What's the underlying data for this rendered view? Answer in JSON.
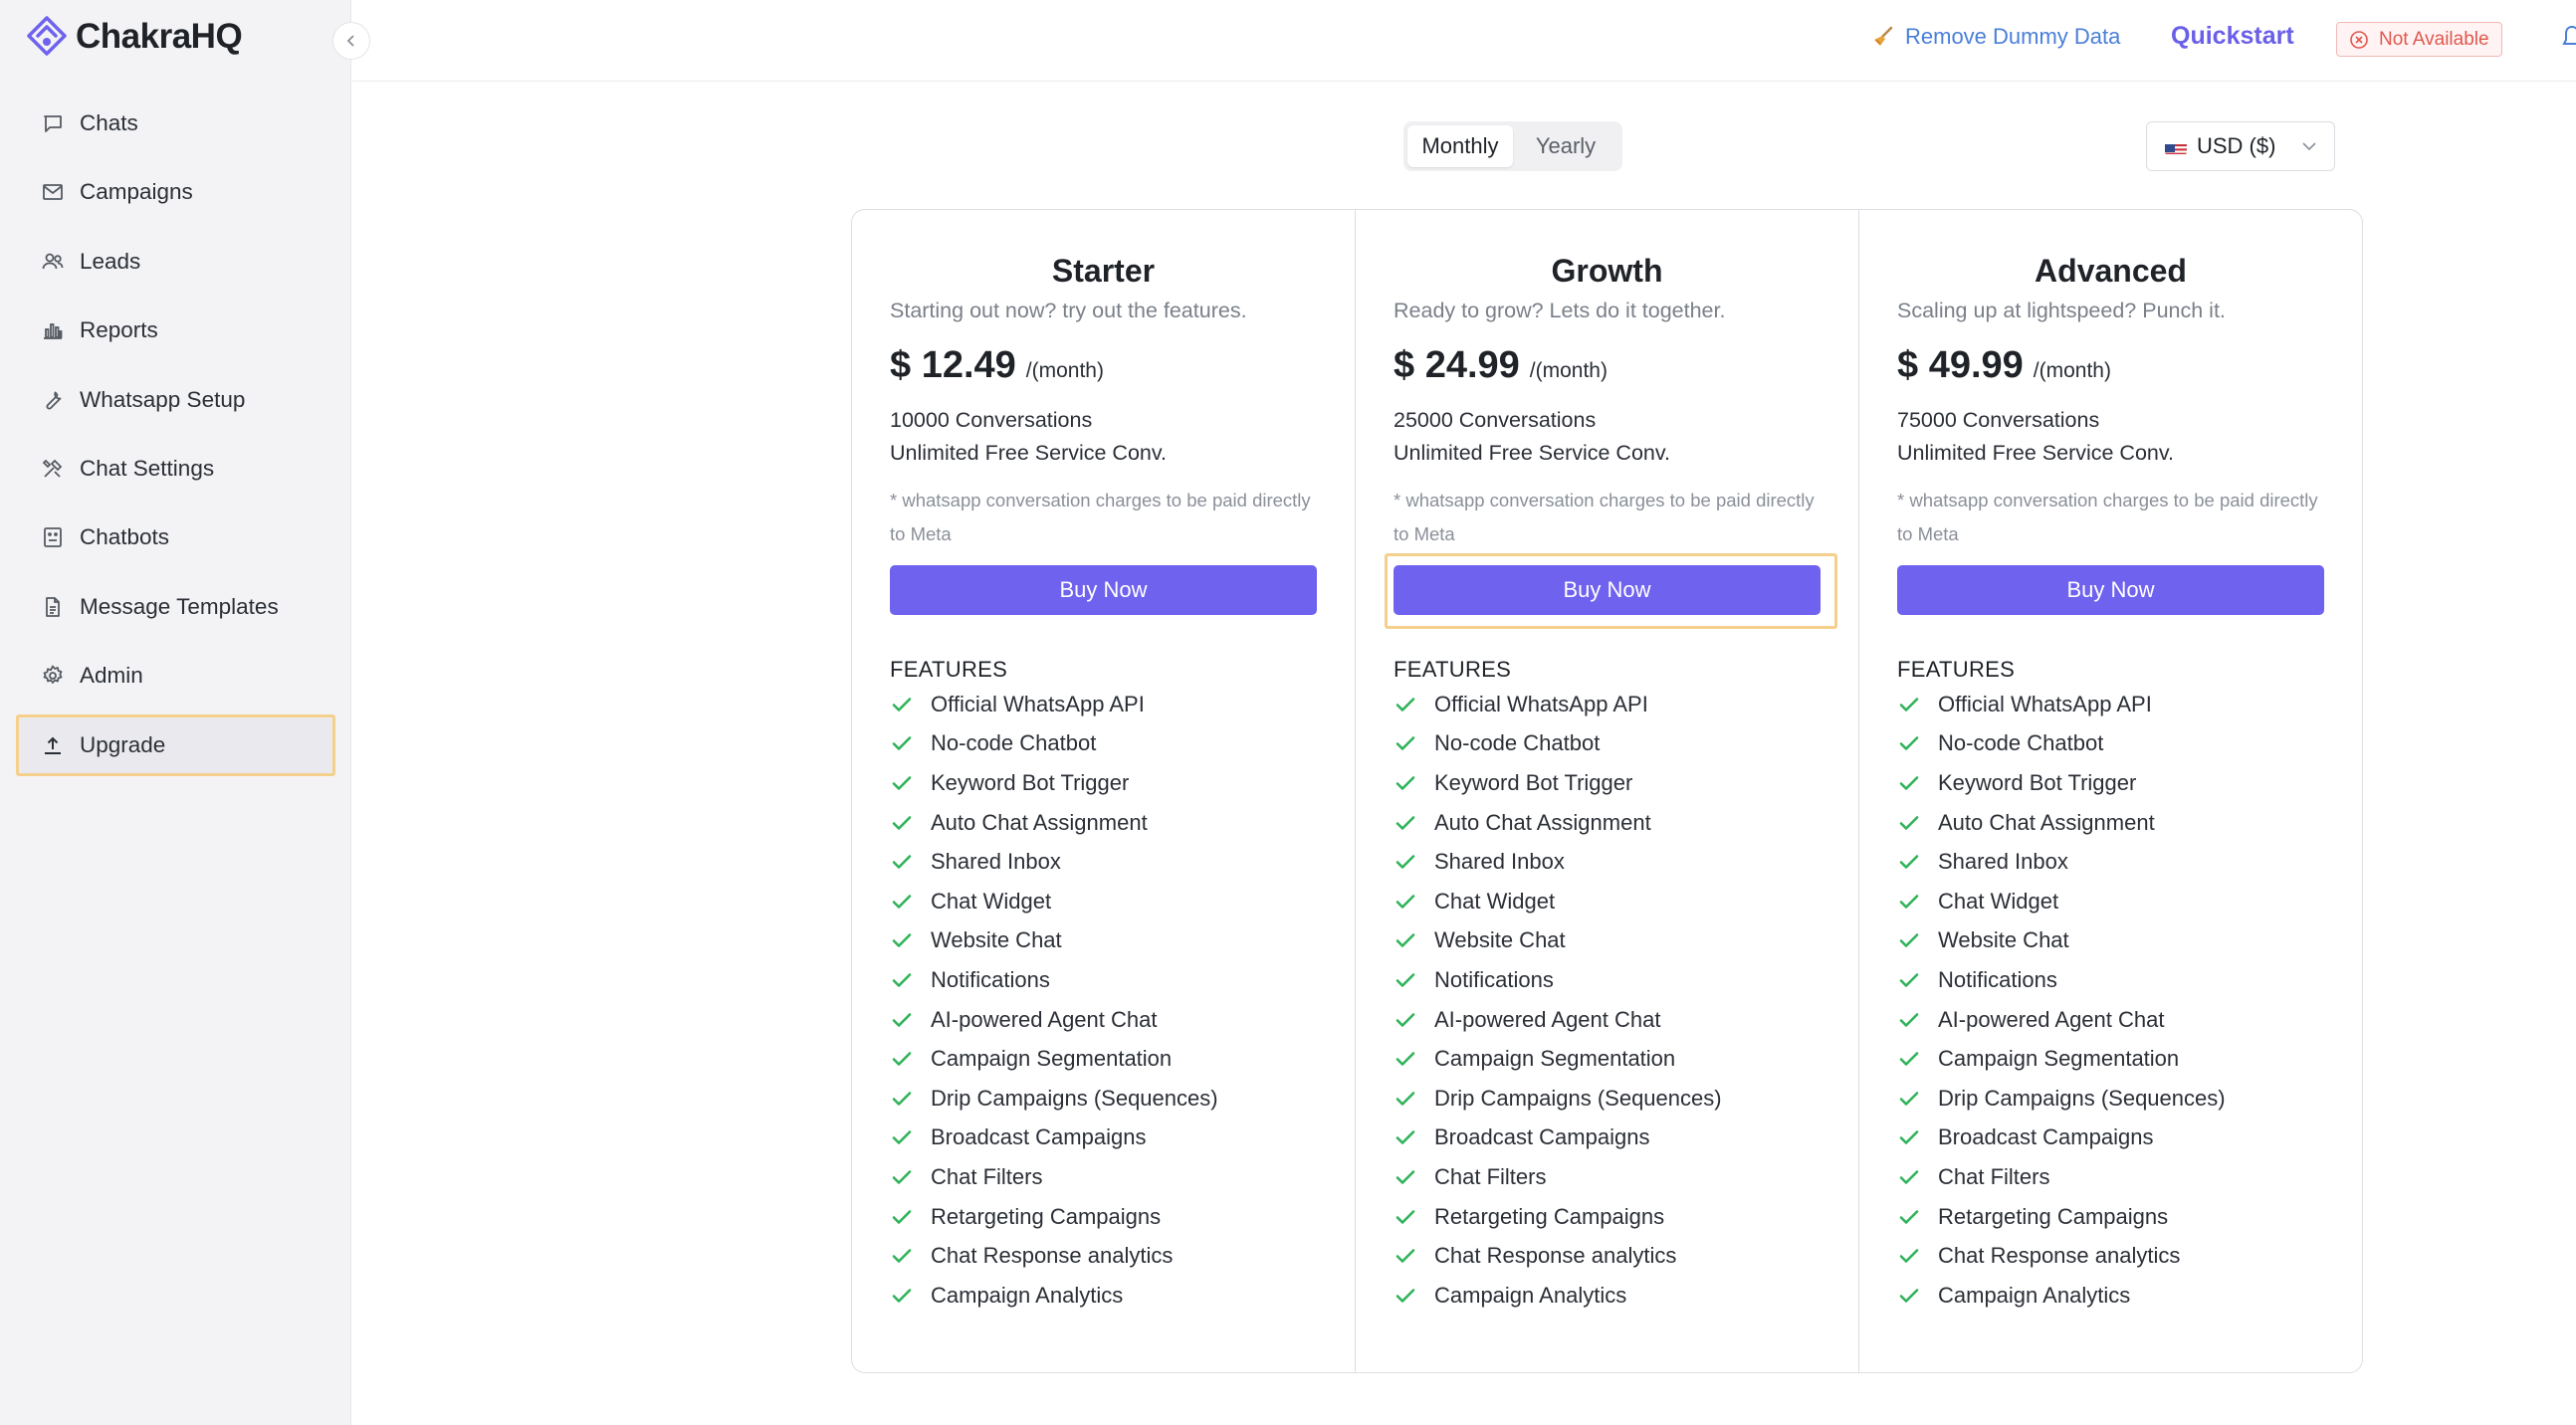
{
  "app": {
    "brand": "ChakraHQ"
  },
  "sidebar": {
    "items": [
      {
        "label": "Chats",
        "icon": "chat-bubble-icon"
      },
      {
        "label": "Campaigns",
        "icon": "mail-icon"
      },
      {
        "label": "Leads",
        "icon": "users-icon"
      },
      {
        "label": "Reports",
        "icon": "bar-chart-icon"
      },
      {
        "label": "Whatsapp Setup",
        "icon": "wrench-icon"
      },
      {
        "label": "Chat Settings",
        "icon": "tools-icon"
      },
      {
        "label": "Chatbots",
        "icon": "bot-icon"
      },
      {
        "label": "Message Templates",
        "icon": "document-icon"
      },
      {
        "label": "Admin",
        "icon": "gear-icon"
      },
      {
        "label": "Upgrade",
        "icon": "upload-icon",
        "active": true
      }
    ]
  },
  "header": {
    "remove_dummy": "Remove Dummy Data",
    "quickstart": "Quickstart",
    "status": "Not Available"
  },
  "billing": {
    "options": [
      "Monthly",
      "Yearly"
    ],
    "selected": "Monthly",
    "currency": "USD ($)"
  },
  "plans": [
    {
      "name": "Starter",
      "tagline": "Starting out now? try out the features.",
      "price": "$ 12.49",
      "period": "/(month)",
      "conversations": "10000 Conversations",
      "service": "Unlimited Free Service Conv.",
      "note": "* whatsapp conversation charges to be paid directly to Meta",
      "cta": "Buy Now",
      "features_title": "FEATURES"
    },
    {
      "name": "Growth",
      "tagline": "Ready to grow? Lets do it together.",
      "price": "$ 24.99",
      "period": "/(month)",
      "conversations": "25000 Conversations",
      "service": "Unlimited Free Service Conv.",
      "note": "* whatsapp conversation charges to be paid directly to Meta",
      "cta": "Buy Now",
      "features_title": "FEATURES"
    },
    {
      "name": "Advanced",
      "tagline": "Scaling up at lightspeed? Punch it.",
      "price": "$ 49.99",
      "period": "/(month)",
      "conversations": "75000 Conversations",
      "service": "Unlimited Free Service Conv.",
      "note": "* whatsapp conversation charges to be paid directly to Meta",
      "cta": "Buy Now",
      "features_title": "FEATURES"
    }
  ],
  "features": [
    "Official WhatsApp API",
    "No-code Chatbot",
    "Keyword Bot Trigger",
    "Auto Chat Assignment",
    "Shared Inbox",
    "Chat Widget",
    "Website Chat",
    "Notifications",
    "AI-powered Agent Chat",
    "Campaign Segmentation",
    "Drip Campaigns (Sequences)",
    "Broadcast Campaigns",
    "Chat Filters",
    "Retargeting Campaigns",
    "Chat Response analytics",
    "Campaign Analytics"
  ],
  "colors": {
    "accent": "#6e62ee",
    "quickstart": "#6a5fe8",
    "link": "#4a7fd8",
    "check": "#2fb35a",
    "highlight": "#f4d08c",
    "danger": "#e0574f"
  }
}
